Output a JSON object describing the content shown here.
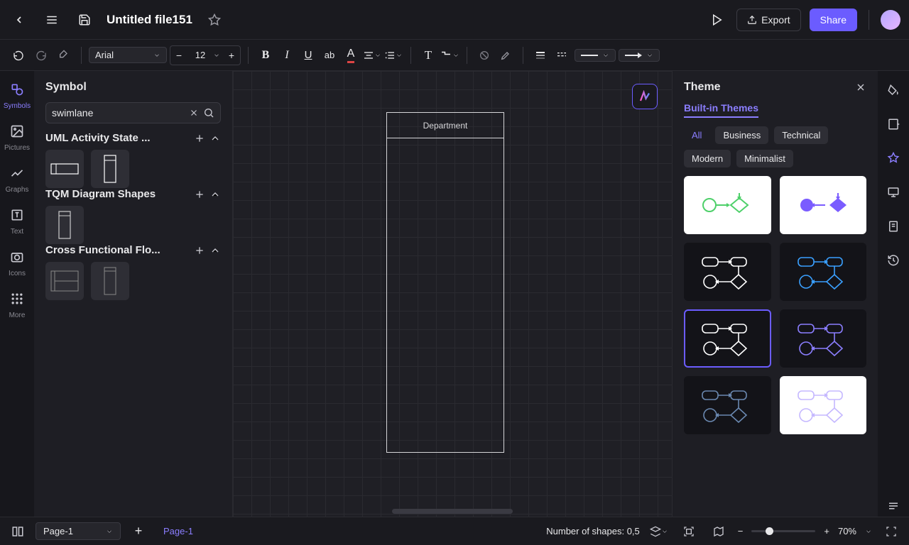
{
  "header": {
    "file_title": "Untitled file151",
    "export_label": "Export",
    "share_label": "Share"
  },
  "toolbar": {
    "font_family": "Arial",
    "font_size": "12"
  },
  "nav_rail": [
    {
      "label": "Symbols",
      "icon": "shapes"
    },
    {
      "label": "Pictures",
      "icon": "image"
    },
    {
      "label": "Graphs",
      "icon": "chart"
    },
    {
      "label": "Text",
      "icon": "text"
    },
    {
      "label": "Icons",
      "icon": "camera"
    },
    {
      "label": "More",
      "icon": "grid"
    }
  ],
  "sidebar": {
    "title": "Symbol",
    "search_value": "swimlane",
    "categories": [
      {
        "name": "UML Activity State ...",
        "thumb_count": 2
      },
      {
        "name": "TQM Diagram Shapes",
        "thumb_count": 1
      },
      {
        "name": "Cross Functional Flo...",
        "thumb_count": 2
      }
    ]
  },
  "canvas": {
    "swimlane_label": "Department"
  },
  "theme": {
    "title": "Theme",
    "tabs": [
      "Built-in Themes"
    ],
    "active_tab": 0,
    "filters": [
      "All",
      "Business",
      "Technical",
      "Modern",
      "Minimalist"
    ],
    "active_filter": 0,
    "cards": [
      {
        "bg": "white",
        "accent": "#4ed06a"
      },
      {
        "bg": "white",
        "accent": "#7a5cff"
      },
      {
        "bg": "dark",
        "accent": "#ffffff"
      },
      {
        "bg": "dark",
        "accent": "#3aa0ff"
      },
      {
        "bg": "dark",
        "accent": "#ffffff",
        "selected": true
      },
      {
        "bg": "dark",
        "accent": "#8b7eff"
      },
      {
        "bg": "dark",
        "accent": "#6a88b0"
      },
      {
        "bg": "white",
        "accent": "#c5b8ff"
      }
    ]
  },
  "statusbar": {
    "page_select": "Page-1",
    "page_tab": "Page-1",
    "shapes_label": "Number of shapes: 0,5",
    "zoom_label": "70%"
  }
}
